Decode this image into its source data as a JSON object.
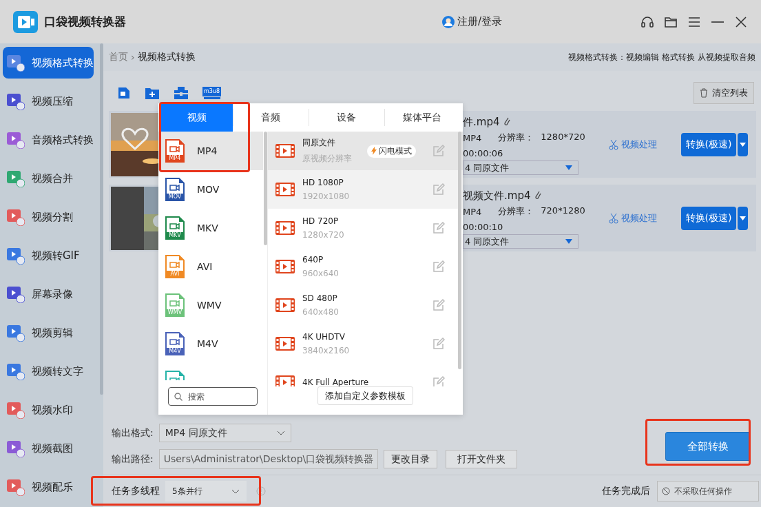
{
  "app": {
    "title": "口袋视频转换器",
    "login": "注册/登录"
  },
  "sidebar": {
    "items": [
      {
        "label": "视频格式转换",
        "selected": true,
        "color": "#5a86e0"
      },
      {
        "label": "视频压缩",
        "selected": false,
        "color": "#4b4fd0"
      },
      {
        "label": "音频格式转换",
        "selected": false,
        "color": "#9b5bd6"
      },
      {
        "label": "视频合并",
        "selected": false,
        "color": "#2fa872"
      },
      {
        "label": "视频分割",
        "selected": false,
        "color": "#e25b5b"
      },
      {
        "label": "视频转GIF",
        "selected": false,
        "color": "#3a78e0"
      },
      {
        "label": "屏幕录像",
        "selected": false,
        "color": "#4b4fd0"
      },
      {
        "label": "视频剪辑",
        "selected": false,
        "color": "#3a78e0"
      },
      {
        "label": "视频转文字",
        "selected": false,
        "color": "#3a78e0"
      },
      {
        "label": "视频水印",
        "selected": false,
        "color": "#e25b5b"
      },
      {
        "label": "视频截图",
        "selected": false,
        "color": "#8b5bd6"
      },
      {
        "label": "视频配乐",
        "selected": false,
        "color": "#e25b5b"
      }
    ]
  },
  "breadcrumb": {
    "items": [
      "首页",
      "视频格式转换"
    ],
    "separator": "›"
  },
  "header_note": "视频格式转换：视频编辑 格式转换 从视频提取音频",
  "toolbar": {
    "m3u8_label": "m3u8",
    "clear_button": "清空列表"
  },
  "files": [
    {
      "name": "件.mp4",
      "format": "MP4",
      "resolution_label": "分辨率：",
      "resolution": "1280*720",
      "duration": "00:00:06",
      "output": "4  同原文件",
      "process": "视频处理",
      "convert": "转换(极速)"
    },
    {
      "name": "视频文件.mp4",
      "format": "MP4",
      "resolution_label": "分辨率：",
      "resolution": "720*1280",
      "duration": "00:00:10",
      "output": "4  同原文件",
      "process": "视频处理",
      "convert": "转换(极速)"
    }
  ],
  "format_popup": {
    "tabs": [
      {
        "label": "视频",
        "selected": true
      },
      {
        "label": "音频",
        "selected": false
      },
      {
        "label": "设备",
        "selected": false
      },
      {
        "label": "媒体平台",
        "selected": false
      }
    ],
    "formats": [
      {
        "label": "MP4",
        "badge": "MP4",
        "color": "#e0461e",
        "selected": true
      },
      {
        "label": "MOV",
        "badge": "MOV",
        "color": "#2a55a8",
        "selected": false
      },
      {
        "label": "MKV",
        "badge": "MKV",
        "color": "#1f8a4c",
        "selected": false
      },
      {
        "label": "AVI",
        "badge": "AVI",
        "color": "#f08a24",
        "selected": false
      },
      {
        "label": "WMV",
        "badge": "WMV",
        "color": "#6cc27a",
        "selected": false
      },
      {
        "label": "M4V",
        "badge": "M4V",
        "color": "#4a62b8",
        "selected": false
      },
      {
        "color": "#26b3a8",
        "selected": false
      }
    ],
    "search": {
      "placeholder": "搜索"
    },
    "presets": [
      {
        "title": "同原文件",
        "subtitle": "原视频分辨率",
        "badge": "闪电模式",
        "selected": true,
        "hovered": false
      },
      {
        "title": "HD 1080P",
        "subtitle": "1920x1080",
        "selected": false,
        "hovered": true
      },
      {
        "title": "HD 720P",
        "subtitle": "1280x720",
        "selected": false,
        "hovered": false
      },
      {
        "title": "640P",
        "subtitle": "960x640",
        "selected": false,
        "hovered": false
      },
      {
        "title": "SD 480P",
        "subtitle": "640x480",
        "selected": false,
        "hovered": false
      },
      {
        "title": "4K UHDTV",
        "subtitle": "3840x2160",
        "selected": false,
        "hovered": false
      },
      {
        "title": "4K Full Aperture",
        "selected": false,
        "hovered": false
      }
    ],
    "add_button": "添加自定义参数模板"
  },
  "output": {
    "format_label": "输出格式:",
    "format_value": "MP4  同原文件",
    "path_label": "输出路径:",
    "path": "Users\\Administrator\\Desktop\\口袋视频转换器",
    "change_dir": "更改目录",
    "open_folder": "打开文件夹",
    "convert_all": "全部转换"
  },
  "status_bar": {
    "threads_label": "任务多线程",
    "threads_value": "5条并行",
    "after_label": "任务完成后",
    "after_value": "不采取任何操作"
  }
}
